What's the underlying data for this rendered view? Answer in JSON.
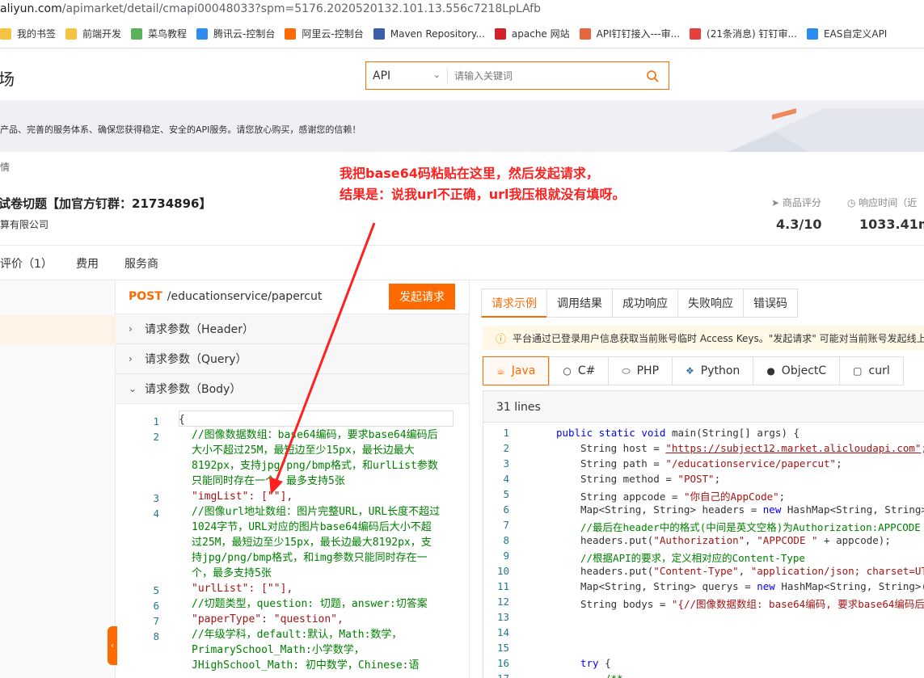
{
  "browser": {
    "url_prefix": "aliyun.com",
    "url_rest": "/apimarket/detail/cmapi00048033?spm=5176.2020520132.101.13.556c7218LpLAfb"
  },
  "bookmarks": [
    {
      "label": "我的书签",
      "color": "#f5c242"
    },
    {
      "label": "前端开发",
      "color": "#f5c242"
    },
    {
      "label": "菜鸟教程",
      "color": "#5bb25b"
    },
    {
      "label": "腾讯云-控制台",
      "color": "#2d8cf0"
    },
    {
      "label": "阿里云-控制台",
      "color": "#ff6a00"
    },
    {
      "label": "Maven Repository...",
      "color": "#3b5ea8"
    },
    {
      "label": "apache 网站",
      "color": "#d22128"
    },
    {
      "label": "API钉钉接入---审...",
      "color": "#e8663d"
    },
    {
      "label": "(21条消息) 钉钉审...",
      "color": "#e83e3e"
    },
    {
      "label": "EAS自定义API",
      "color": "#2d8cf0"
    }
  ],
  "header": {
    "logo_fragment": "场",
    "search_scope": "API",
    "search_placeholder": "请输入关键词"
  },
  "banner": {
    "text": "产品、完善的服务体系、确保您获得稳定、安全的API服务。请您放心购买，感谢您的信赖！"
  },
  "product": {
    "crumb": "情",
    "title": "试卷切题【加官方钉群：21734896】",
    "company": "算有限公司",
    "rating_label": "商品评分",
    "rating_value": "4.3/10",
    "response_label": "响应时间（近",
    "response_value": "1033.41m"
  },
  "annotation": {
    "line1": "我把base64码粘贴在这里，然后发起请求，",
    "line2": "结果是：说我url不正确，url我压根就没有填呀。"
  },
  "page_tabs": [
    "评价（1）",
    "费用",
    "服务商"
  ],
  "request": {
    "method": "POST",
    "path": "/educationservice/papercut",
    "send_label": "发起请求",
    "header_params": "请求参数（Header）",
    "query_params": "请求参数（Query）",
    "body_params": "请求参数（Body）"
  },
  "body_editor": {
    "line_numbers": [
      "1",
      "2",
      "3",
      "4",
      "5",
      "6",
      "7",
      "8"
    ],
    "lines": [
      "{",
      "//图像数据数组：base64编码，要求base64编码后大小不超过25M，最短边至少15px，最长边最大8192px，支持jpg/png/bmp格式，和urlList参数只能同时存在一个，最多支持5张",
      "\"imgList\": [\"\"],",
      "//图像url地址数组：图片完整URL，URL长度不超过1024字节，URL对应的图片base64编码后大小不超过25M，最短边至少15px，最长边最大8192px，支持jpg/png/bmp格式，和img参数只能同时存在一个，最多支持5张",
      "\"urlList\": [\"\"],",
      "//切题类型，question: 切题，answer:切答案",
      "\"paperType\": \"question\",",
      "//年级学科，default:默认，Math:数学，PrimarySchool_Math:小学数学，JHighSchool_Math: 初中数学，Chinese:语"
    ]
  },
  "right_tabs": [
    "请求示例",
    "调用结果",
    "成功响应",
    "失败响应",
    "错误码"
  ],
  "notice": "平台通过已登录用户信息获取当前账号临时 Access Keys。\"发起请求\" 可能对当前账号发起线上",
  "languages": [
    {
      "label": "Java",
      "icon": "java-icon"
    },
    {
      "label": "C#",
      "icon": "csharp-icon"
    },
    {
      "label": "PHP",
      "icon": "php-icon"
    },
    {
      "label": "Python",
      "icon": "python-icon"
    },
    {
      "label": "ObjectC",
      "icon": "apple-icon"
    },
    {
      "label": "curl",
      "icon": "terminal-icon"
    }
  ],
  "code": {
    "lines_header": "31 lines",
    "line_numbers": [
      "1",
      "2",
      "3",
      "4",
      "5",
      "6",
      "7",
      "8",
      "9",
      "10",
      "11",
      "12",
      "13",
      "14",
      "15",
      "16",
      "17"
    ]
  }
}
